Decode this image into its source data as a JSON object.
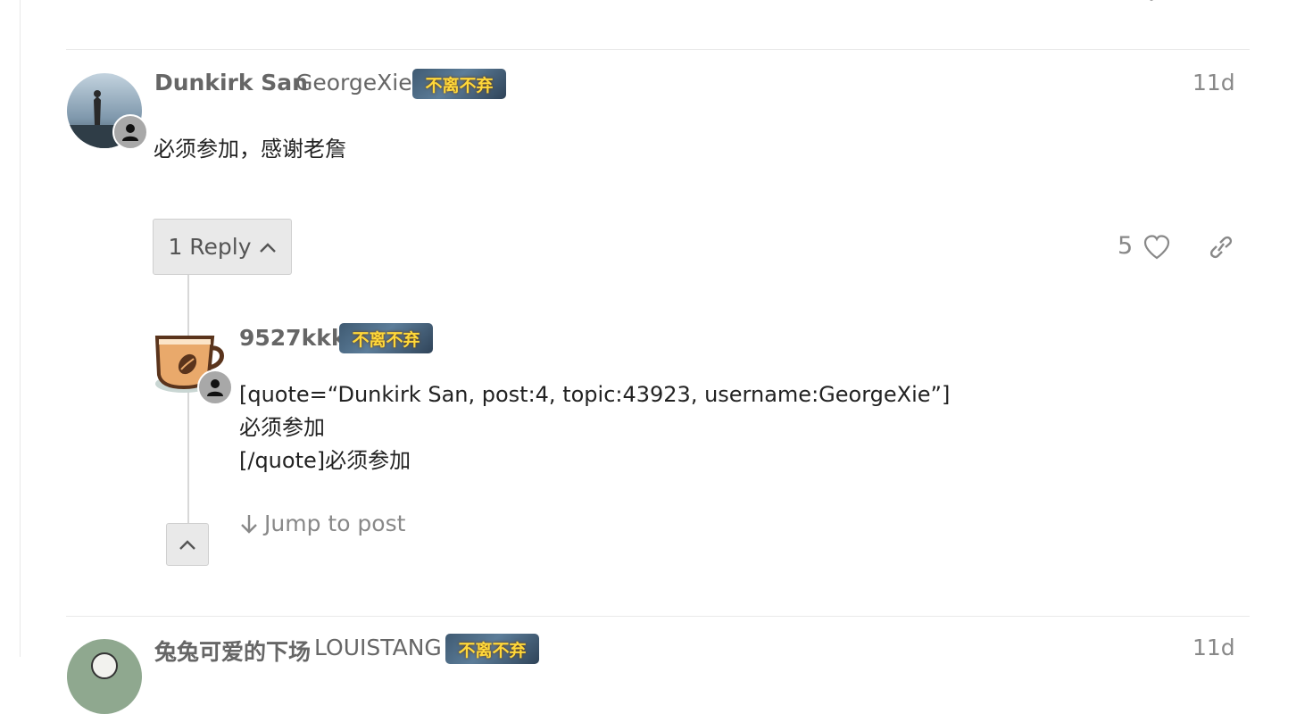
{
  "post": {
    "display_name": "Dunkirk San",
    "username": "GeorgeXie",
    "flair_text": "不离不弃",
    "time": "11d",
    "body": "必须参加，感谢老詹",
    "reply_button_label": "1 Reply",
    "like_count": "5"
  },
  "reply": {
    "username": "9527kkk",
    "flair_text": "不离不弃",
    "body_lines": [
      "[quote=“Dunkirk San, post:4, topic:43923, username:GeorgeXie”]",
      "必须参加",
      "[/quote]必须参加"
    ],
    "jump_label": "Jump to post"
  },
  "next_post": {
    "display_name": "兔兔可爱的下场",
    "username": "LOUISTANG",
    "flair_text": "不离不弃",
    "time": "11d"
  },
  "icons": {
    "like": "heart-icon",
    "share": "link-icon",
    "expand": "chevron-up-icon",
    "jump": "arrow-down-icon",
    "status": "user-icon"
  },
  "colors": {
    "flair_text": "#ffd83a",
    "flair_bg": "#4a6782",
    "muted": "#888888",
    "button_bg": "#e9e9e9"
  }
}
